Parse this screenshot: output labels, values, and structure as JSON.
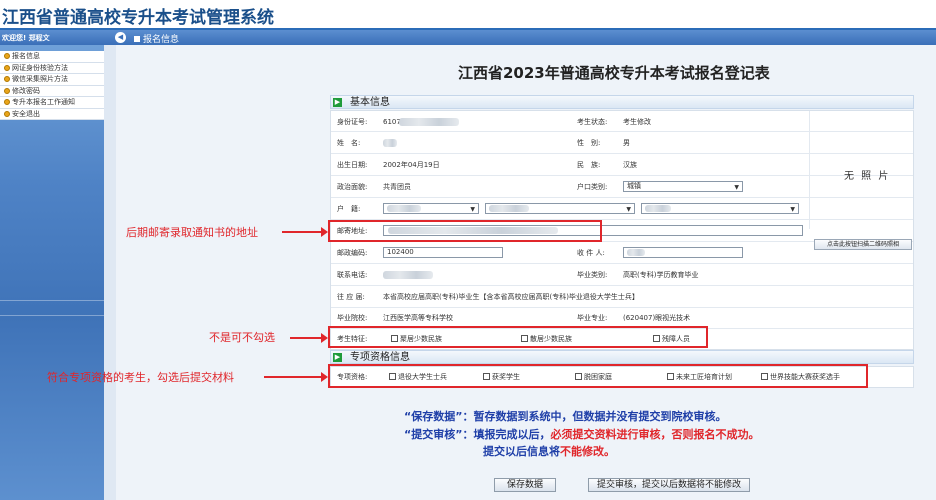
{
  "header": {
    "title": "江西省普通高校专升本考试管理系统"
  },
  "topbar": {
    "welcome": "欢迎您! 郑程文",
    "collapse_icon": "◀",
    "breadcrumb": "报名信息"
  },
  "sidebar": {
    "items": [
      {
        "label": "报名信息"
      },
      {
        "label": "网证身份核验方法"
      },
      {
        "label": "微信采集照片方法"
      },
      {
        "label": "修改密码"
      },
      {
        "label": "专升本报名工作通知"
      },
      {
        "label": "安全退出"
      }
    ]
  },
  "form": {
    "title": "江西省2023年普通高校专升本考试报名登记表",
    "section1_icon": "▶",
    "section1": "基本信息",
    "section2_icon": "▶",
    "section2": "专项资格信息",
    "fields": {
      "id_label": "身份证号:",
      "id_value": "6107",
      "status_label": "考生状态:",
      "status_value": "考生修改",
      "name_label": "姓　名:",
      "gender_label": "性　别:",
      "gender_value": "男",
      "birth_label": "出生日期:",
      "birth_value": "2002年04月19日",
      "ethnic_label": "民　族:",
      "ethnic_value": "汉族",
      "politics_label": "政治面貌:",
      "politics_value": "共青团员",
      "hukou_label": "户口类别:",
      "hukou_value": "城镇",
      "domicile_label": "户　籍:",
      "address_label": "邮寄地址:",
      "postcode_label": "邮政编码:",
      "postcode_value": "102400",
      "recipient_label": "收 件 人:",
      "phone_label": "联系电话:",
      "grad_type_label": "毕业类别:",
      "grad_type_value": "高职(专科)学历教育毕业",
      "prev_label": "往 应 届:",
      "prev_value": "本省高校应届高职(专科)毕业生【含本省高校应届高职(专科)毕业退役大学生士兵】",
      "school_label": "毕业院校:",
      "school_value": "江西医学高等专科学校",
      "major_label": "毕业专业:",
      "major_value": "(620407)眼视光技术",
      "feature_label": "考生特征:",
      "feature_options": [
        "聚居少数民族",
        "散居少数民族",
        "残障人员"
      ],
      "qual_label": "专项资格:",
      "qual_options": [
        "退役大学生士兵",
        "获奖学生",
        "脱困家庭",
        "未来工匠培育计划",
        "世界技能大赛获奖选手"
      ]
    },
    "photo": {
      "no_photo": "无 照 片",
      "scan_button": "点击此按钮扫描二维码照相"
    }
  },
  "annotations": {
    "mail": "后期邮寄录取通知书的地址",
    "optional": "不是可不勾选",
    "special": "符合专项资格的考生，勾选后提交材料"
  },
  "notes": {
    "save_term": "“保存数据”：",
    "save_desc": "暂存数据到系统中，但数据并没有提交到院校审核。",
    "submit_term": "“提交审核”：",
    "submit_desc1": "填报完成以后，",
    "submit_desc_red": "必须提交资料进行审核，否则报名不成功。",
    "after_submit1": "提交以后信息将",
    "after_submit_red": "不能修改。"
  },
  "buttons": {
    "save": "保存数据",
    "submit": "提交审核，提交以后数据将不能修改"
  }
}
